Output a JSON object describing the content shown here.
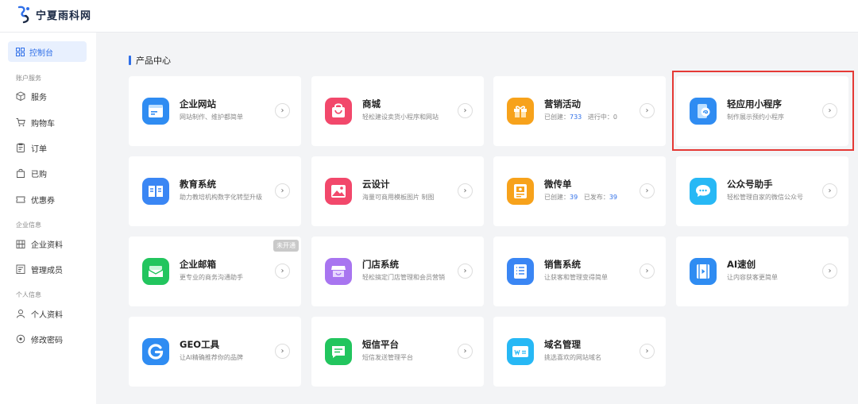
{
  "logo": {
    "text": "宁夏雨科网"
  },
  "sidebar": {
    "active": {
      "label": "控制台",
      "icon": "dashboard-icon"
    },
    "groups": [
      {
        "label": "账户服务"
      },
      {
        "label": "企业信息"
      },
      {
        "label": "个人信息"
      }
    ],
    "items": [
      {
        "label": "服务",
        "icon": "box-icon"
      },
      {
        "label": "购物车",
        "icon": "cart-icon"
      },
      {
        "label": "订单",
        "icon": "order-icon"
      },
      {
        "label": "已购",
        "icon": "bag-icon"
      },
      {
        "label": "优惠券",
        "icon": "coupon-icon"
      },
      {
        "label": "企业资料",
        "icon": "building-icon"
      },
      {
        "label": "管理成员",
        "icon": "members-icon"
      },
      {
        "label": "个人资料",
        "icon": "user-icon"
      },
      {
        "label": "修改密码",
        "icon": "lock-icon"
      }
    ]
  },
  "main": {
    "section_title": "产品中心",
    "cards": [
      {
        "title": "企业网站",
        "desc": "网站制作、维护都简单",
        "icon": "website-icon",
        "color": "#2f8cf2"
      },
      {
        "title": "商城",
        "desc": "轻松建设卖货小程序和网站",
        "icon": "shop-bag-icon",
        "color": "#f2486b"
      },
      {
        "title": "营销活动",
        "desc_prefix": "已创建：",
        "num1": "733",
        "desc_mid": "   进行中：",
        "num2": "0",
        "icon": "gift-icon",
        "color": "#f7a21b"
      },
      {
        "title": "轻应用小程序",
        "desc": "制作展示预约小程序",
        "icon": "miniapp-icon",
        "color": "#2f8cf2"
      },
      {
        "title": "教育系统",
        "desc": "助力教培机构数字化转型升级",
        "icon": "book-icon",
        "color": "#3a86f4"
      },
      {
        "title": "云设计",
        "desc": "海量可商用模板图片 制图",
        "icon": "image-icon",
        "color": "#f2486b"
      },
      {
        "title": "微传单",
        "desc_prefix": "已创建：",
        "num1": "39",
        "desc_mid": "   已发布：",
        "num2": "39",
        "icon": "flyer-icon",
        "color": "#f7a21b"
      },
      {
        "title": "公众号助手",
        "desc": "轻松管理自家的微信公众号",
        "icon": "chat-icon",
        "color": "#27b8f5"
      },
      {
        "title": "企业邮箱",
        "desc": "更专业的商务沟通助手",
        "icon": "mail-icon",
        "color": "#22c55e",
        "badge": "未开通"
      },
      {
        "title": "门店系统",
        "desc": "轻松搞定门店管理和会员营销",
        "icon": "store-icon",
        "color": "#a875f0"
      },
      {
        "title": "销售系统",
        "desc": "让获客和管理变得简单",
        "icon": "list-icon",
        "color": "#3a86f4"
      },
      {
        "title": "AI速创",
        "desc": "让内容获客更简单",
        "icon": "video-icon",
        "color": "#2f8cf2"
      },
      {
        "title": "GEO工具",
        "desc": "让AI精确推荐你的品牌",
        "icon": "geo-icon",
        "color": "#2f8cf2"
      },
      {
        "title": "短信平台",
        "desc": "短信发送管理平台",
        "icon": "sms-icon",
        "color": "#22c55e"
      },
      {
        "title": "域名管理",
        "desc": "挑选喜欢的网站域名",
        "icon": "domain-icon",
        "color": "#27b8f5"
      }
    ]
  },
  "colors": {
    "accent": "#2f6fe8",
    "highlight": "#e53935"
  }
}
